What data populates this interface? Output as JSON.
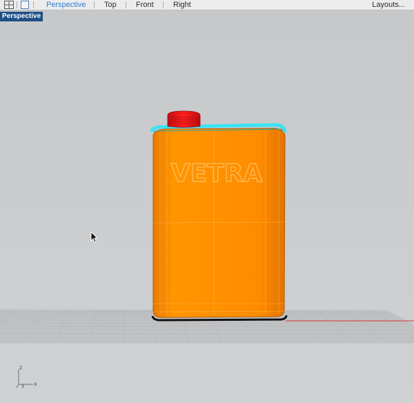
{
  "tabs": [
    {
      "label": "Perspective",
      "active": true
    },
    {
      "label": "Top",
      "active": false
    },
    {
      "label": "Front",
      "active": false
    },
    {
      "label": "Right",
      "active": false
    }
  ],
  "layouts_label": "Layouts...",
  "viewport": {
    "name": "Perspective",
    "label_bg": "#1e4f86",
    "bg_color": "#c8cacc"
  },
  "model": {
    "text": "VETRA",
    "body_color": "#ff8a00",
    "cap_color": "#e8161a",
    "rim_color": "#39e3f2",
    "base_color": "#111111"
  },
  "axis": {
    "z": "z",
    "y": "y",
    "x": "x"
  },
  "icons": {
    "grid_layout": "four-viewports-icon",
    "single_viewport": "single-viewport-icon",
    "cursor": "mouse-pointer-icon"
  },
  "colors": {
    "tab_active": "#2d7fd3",
    "world_x_axis": "#d0312d"
  }
}
